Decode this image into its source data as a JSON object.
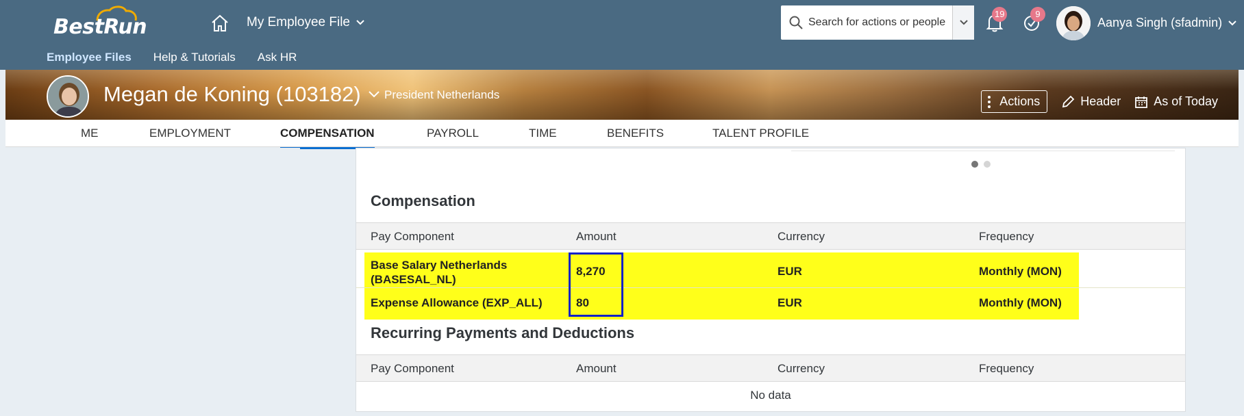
{
  "shell": {
    "logo_text": "BestRun",
    "app_title": "My Employee File",
    "search_placeholder": "Search for actions or people",
    "notifications_count": "19",
    "todo_count": "9",
    "user_name": "Aanya Singh (sfadmin)",
    "nav": [
      "Employee Files",
      "Help & Tutorials",
      "Ask HR"
    ]
  },
  "employee": {
    "name": "Megan de Koning (103182)",
    "title": "President Netherlands",
    "actions_label": "Actions",
    "header_label": "Header",
    "as_of_label": "As of Today"
  },
  "tabs": [
    "ME",
    "EMPLOYMENT",
    "COMPENSATION",
    "PAYROLL",
    "TIME",
    "BENEFITS",
    "TALENT PROFILE"
  ],
  "active_tab": "COMPENSATION",
  "compensation": {
    "title": "Compensation",
    "columns": [
      "Pay Component",
      "Amount",
      "Currency",
      "Frequency"
    ],
    "rows": [
      {
        "pay_component_line1": "Base Salary Netherlands",
        "pay_component_line2": "(BASESAL_NL)",
        "amount": "8,270",
        "currency": "EUR",
        "frequency": "Monthly (MON)"
      },
      {
        "pay_component_line1": "Expense Allowance (EXP_ALL)",
        "pay_component_line2": "",
        "amount": "80",
        "currency": "EUR",
        "frequency": "Monthly (MON)"
      }
    ]
  },
  "recurring": {
    "title": "Recurring Payments and Deductions",
    "columns": [
      "Pay Component",
      "Amount",
      "Currency",
      "Frequency"
    ],
    "empty_text": "No data"
  },
  "colors": {
    "shell_bg": "#4a6a82",
    "highlight": "#ffff1a",
    "amount_box": "#1022c8",
    "badge": "#e6788a",
    "tab_indicator": "#0a6ed1"
  }
}
